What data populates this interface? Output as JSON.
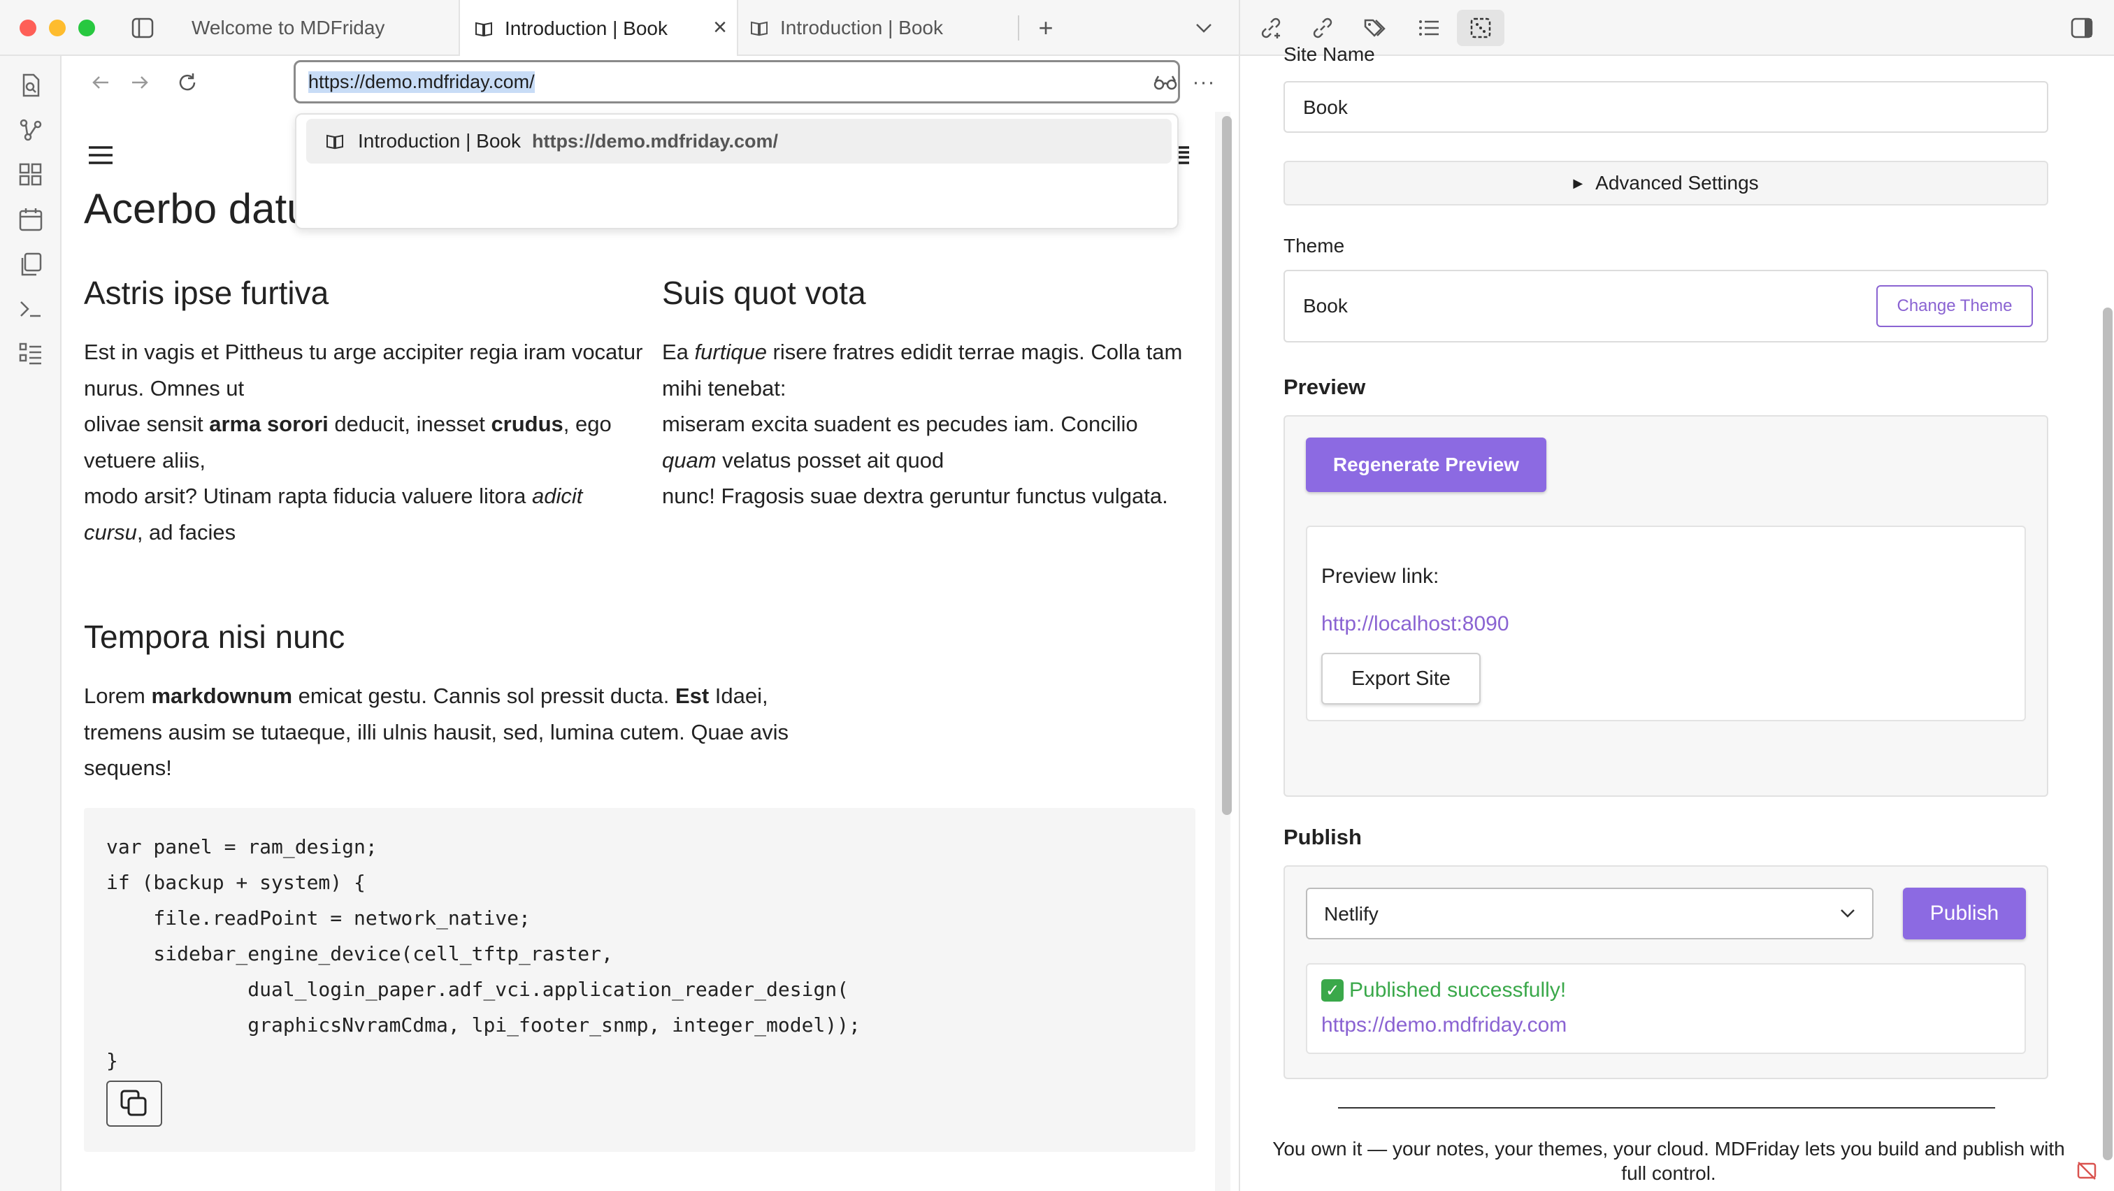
{
  "tabs": [
    {
      "label": "Welcome to MDFriday"
    },
    {
      "label": "Introduction | Book"
    },
    {
      "label": "Introduction | Book"
    }
  ],
  "browser": {
    "url": "https://demo.mdfriday.com/",
    "suggestion": {
      "title": "Introduction | Book",
      "url": "https://demo.mdfriday.com/"
    }
  },
  "page": {
    "title": "Acerbo datus maxime",
    "col1_heading": "Astris ipse furtiva",
    "col2_heading": "Suis quot vota",
    "section3_heading": "Tempora nisi nunc",
    "code": "var panel = ram_design;\nif (backup + system) {\n    file.readPoint = network_native;\n    sidebar_engine_device(cell_tftp_raster,\n            dual_login_paper.adf_vci.application_reader_design(\n            graphicsNvramCdma, lpi_footer_snmp, integer_model));\n}"
  },
  "panel": {
    "site_name_label": "Site Name",
    "site_name_value": "Book",
    "advanced_settings": "Advanced Settings",
    "theme_label": "Theme",
    "theme_value": "Book",
    "change_theme": "Change Theme",
    "preview_header": "Preview",
    "regenerate_preview": "Regenerate Preview",
    "preview_link_label": "Preview link:",
    "preview_link": "http://localhost:8090",
    "export_site": "Export Site",
    "publish_header": "Publish",
    "publish_target": "Netlify",
    "publish_button": "Publish",
    "publish_status": "Published successfully!",
    "published_url": "https://demo.mdfriday.com",
    "footer_text": "You own it — your notes, your themes, your cloud. MDFriday lets you build and publish with full control."
  },
  "colors": {
    "accent": "#8c6ae2",
    "link": "#8a63d2",
    "success": "#3aa84a"
  },
  "icons": [
    "sidebar-toggle-icon",
    "book-icon",
    "close-icon",
    "plus-icon",
    "chevron-down-icon",
    "link-icon",
    "tag-icon",
    "list-icon",
    "dice-icon",
    "reading-glasses-icon",
    "more-icon",
    "back-icon",
    "forward-icon",
    "reload-icon",
    "hamburger-icon",
    "toc-icon",
    "copy-icon",
    "checkmark-icon"
  ]
}
